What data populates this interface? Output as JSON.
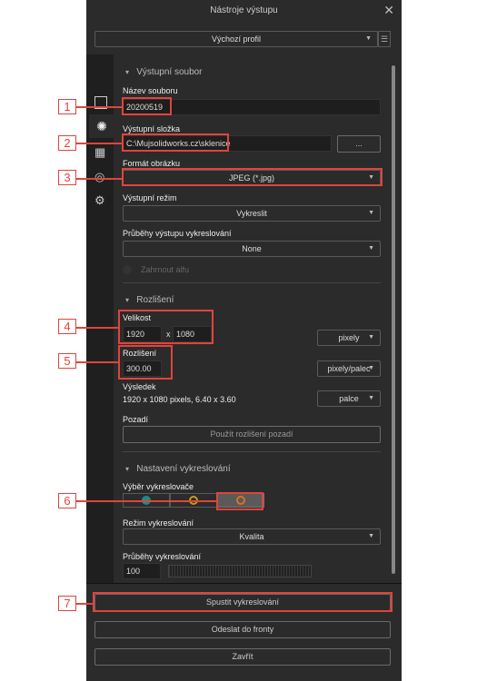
{
  "window": {
    "title": "Nástroje výstupu",
    "close_icon": "close-icon"
  },
  "profile": {
    "value": "Výchozí profil"
  },
  "output_file": {
    "section": "Výstupní soubor",
    "filename_label": "Název souboru",
    "filename": "20200519",
    "folder_label": "Výstupní složka",
    "folder": "C:\\Mujsolidworks.cz\\sklenice",
    "browse": "...",
    "format_label": "Formát obrázku",
    "format": "JPEG (*.jpg)",
    "mode_label": "Výstupní režim",
    "mode": "Vykreslit",
    "passes_label": "Průběhy výstupu vykreslování",
    "passes": "None",
    "alpha_label": "Zahrnout alfu"
  },
  "resolution": {
    "section": "Rozlišení",
    "size_label": "Velikost",
    "width": "1920",
    "x": "x",
    "height": "1080",
    "size_unit": "pixely",
    "res_label": "Rozlišení",
    "res": "300.00",
    "res_unit": "pixely/palec",
    "result_label": "Výsledek",
    "result": "1920 x 1080 pixels, 6.40 x 3.60",
    "result_unit": "palce",
    "bg_label": "Pozadí",
    "bg_button": "Použít rozlišení pozadí"
  },
  "render": {
    "section": "Nastavení vykreslování",
    "renderer_label": "Výběr vykreslovače",
    "renderer_colors": [
      "#1e8c88",
      "#c89a1a",
      "#e0701e"
    ],
    "selected_renderer": 3,
    "mode_label": "Režim vykreslování",
    "mode": "Kvalita",
    "passes_label": "Průběhy vykreslování",
    "passes": "100"
  },
  "buttons": {
    "start": "Spustit vykreslování",
    "queue": "Odeslat do fronty",
    "close": "Zavřít"
  },
  "annotations": [
    "1",
    "2",
    "3",
    "4",
    "5",
    "6",
    "7"
  ],
  "accent": "#e0443c"
}
